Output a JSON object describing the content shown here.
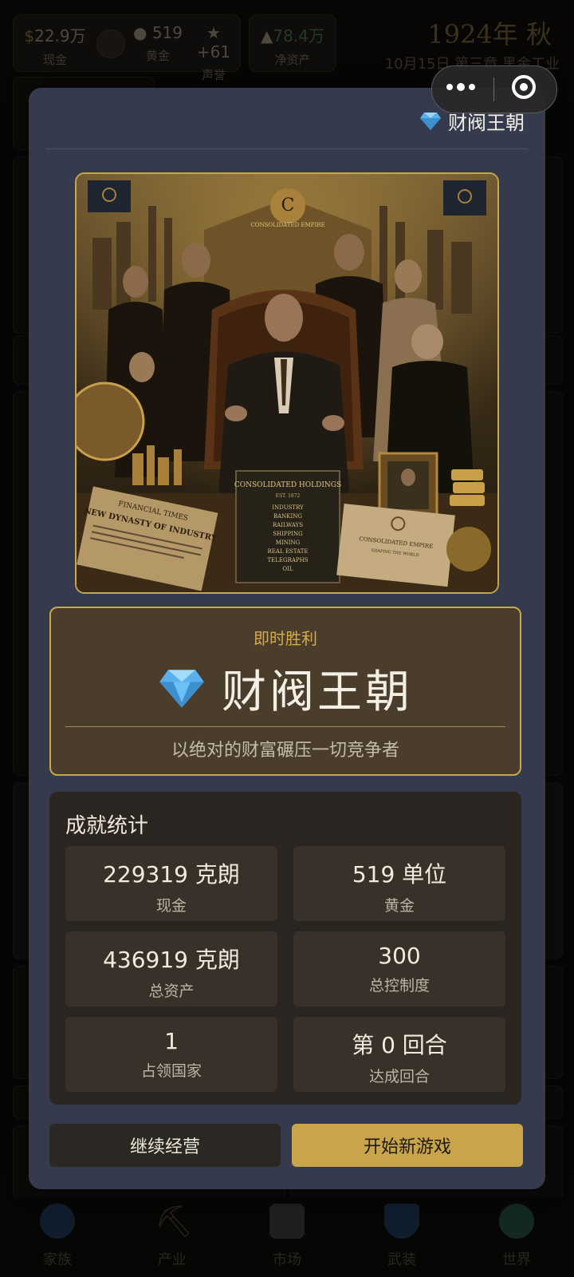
{
  "topbar": {
    "cash": {
      "value": "22.9万",
      "label": "现金"
    },
    "gold": {
      "value": "519",
      "label": "黄金"
    },
    "prestige": {
      "value": "+61",
      "label": "声誉"
    },
    "net_assets": {
      "value": "78.4万",
      "label": "净资产"
    },
    "year": "1924年 秋",
    "date": "10月15日 第三章 黑金工业"
  },
  "nav": [
    {
      "label": "家族"
    },
    {
      "label": "产业"
    },
    {
      "label": "市场"
    },
    {
      "label": "武装"
    },
    {
      "label": "世界"
    }
  ],
  "modal": {
    "header_title": "财阀王朝",
    "header_icon": "diamond-icon",
    "art": {
      "flag_text": "CONSOLIDATED EMPIRE",
      "newspaper_title": "FINANCIAL TIMES",
      "newspaper_headline": "NEW DYNASTY OF INDUSTRY",
      "book_title": "CONSOLIDATED HOLDINGS",
      "book_est": "EST. 1872",
      "book_items": [
        "INDUSTRY",
        "BANKING",
        "RAILWAYS",
        "SHIPPING",
        "MINING",
        "REAL ESTATE",
        "TELEGRAPHS",
        "OIL"
      ],
      "document_title": "CONSOLIDATED EMPIRE",
      "document_sub": "SHAPING THE WORLD"
    },
    "victory_label": "即时胜利",
    "victory_title": "财阀王朝",
    "victory_desc": "以绝对的财富碾压一切竞争者",
    "stats_title": "成就统计",
    "stats": [
      {
        "value": "229319 克朗",
        "label": "现金"
      },
      {
        "value": "519 单位",
        "label": "黄金"
      },
      {
        "value": "436919 克朗",
        "label": "总资产"
      },
      {
        "value": "300",
        "label": "总控制度"
      },
      {
        "value": "1",
        "label": "占领国家"
      },
      {
        "value": "第 0 回合",
        "label": "达成回合"
      }
    ],
    "btn_continue": "继续经营",
    "btn_new_game": "开始新游戏"
  },
  "colors": {
    "modal_bg": "#353b4d",
    "accent_gold": "#c9a44a",
    "victory_bg": "#4a3d2b"
  }
}
